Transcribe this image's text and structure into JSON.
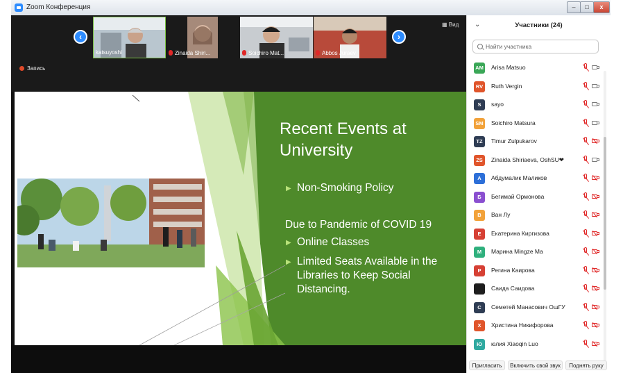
{
  "window": {
    "title": "Zoom Конференция",
    "controls": [
      "–",
      "□",
      "x"
    ]
  },
  "video_strip": {
    "view_label": "Вид",
    "recording_label": "Запись",
    "tiles": [
      {
        "name": "katsuyoshi",
        "muted": false
      },
      {
        "name": "Zinaida Shiri...",
        "muted": true
      },
      {
        "name": "Soichiro Mat...",
        "muted": true
      },
      {
        "name": "Abbos Juraev",
        "muted": true
      }
    ]
  },
  "slide": {
    "title_line1": "Recent Events at",
    "title_line2": "University",
    "bullet1": "Non-Smoking Policy",
    "subhead": "Due to Pandemic of COVID 19",
    "bullet2": "Online Classes",
    "bullet3_line1": "Limited Seats Available in the",
    "bullet3_line2": "Libraries to Keep Social",
    "bullet3_line3": "Distancing."
  },
  "participants_panel": {
    "title": "Участники (24)",
    "search_placeholder": "Найти участника",
    "participants": [
      {
        "initials": "AM",
        "name": "Arisa Matsuo",
        "color": "#3aa757",
        "cam_off": false
      },
      {
        "initials": "RV",
        "name": "Ruth Vergin",
        "color": "#e0552b",
        "cam_off": false
      },
      {
        "initials": "S",
        "name": "sayo",
        "color": "#2f3d54",
        "cam_off": false
      },
      {
        "initials": "SM",
        "name": "Soichiro Matsura",
        "color": "#f2a23a",
        "cam_off": false
      },
      {
        "initials": "TZ",
        "name": "Timur Zulpukarov",
        "color": "#2f3d54",
        "cam_off": true
      },
      {
        "initials": "ZS",
        "name": "Zinaida Shiriaeva, OshSU❤",
        "color": "#e0552b",
        "cam_off": false
      },
      {
        "initials": "А",
        "name": "Абдумалик Маликов",
        "color": "#2d6fd8",
        "cam_off": true
      },
      {
        "initials": "Б",
        "name": "Бегимай Ормонова",
        "color": "#8a4fd0",
        "cam_off": true
      },
      {
        "initials": "В",
        "name": "Ван Лу",
        "color": "#f2a23a",
        "cam_off": true
      },
      {
        "initials": "Е",
        "name": "Екатерина Киргизова",
        "color": "#d64034",
        "cam_off": true
      },
      {
        "initials": "М",
        "name": "Марина Mingze Ma",
        "color": "#2fb07d",
        "cam_off": true
      },
      {
        "initials": "Р",
        "name": "Регина Каирова",
        "color": "#d64034",
        "cam_off": true
      },
      {
        "initials": "",
        "name": "Саида Саидова",
        "color": "#1e1e1e",
        "cam_off": true
      },
      {
        "initials": "С",
        "name": "Семетей Манасович ОшГУ",
        "color": "#2f3d54",
        "cam_off": true
      },
      {
        "initials": "Х",
        "name": "Христина Никифорова",
        "color": "#e0552b",
        "cam_off": true
      },
      {
        "initials": "Ю",
        "name": "юлия Xiaoqin Luo",
        "color": "#2fa9a0",
        "cam_off": true
      }
    ],
    "footer": {
      "invite": "Пригласить",
      "unmute": "Включить свой звук",
      "raise_hand": "Поднять руку"
    }
  }
}
